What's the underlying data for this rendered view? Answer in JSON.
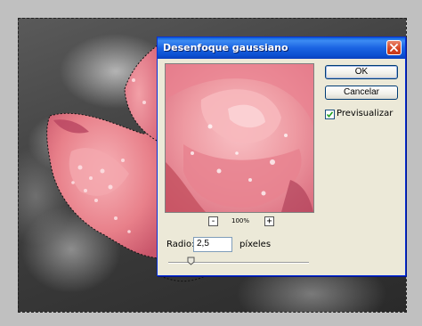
{
  "dialog": {
    "title": "Desenfoque gaussiano",
    "ok_label": "OK",
    "cancel_label": "Cancelar",
    "preview_label": "Previsualizar",
    "preview_checked": true,
    "zoom_minus": "-",
    "zoom_plus": "+",
    "zoom_level": "100%",
    "radius_label": "Radio:",
    "radius_value": "2,5",
    "radius_unit": "píxeles",
    "radius_slider_fraction": 0.16
  },
  "colors": {
    "titlebar": "#0a5fd8",
    "dialog_bg": "#ece9d8",
    "rose": "#e98a93",
    "canvas_gray": "#3e3e3e"
  },
  "icons": {
    "close": "close-icon",
    "check": "checkmark-icon",
    "slider": "slider-thumb-icon"
  }
}
